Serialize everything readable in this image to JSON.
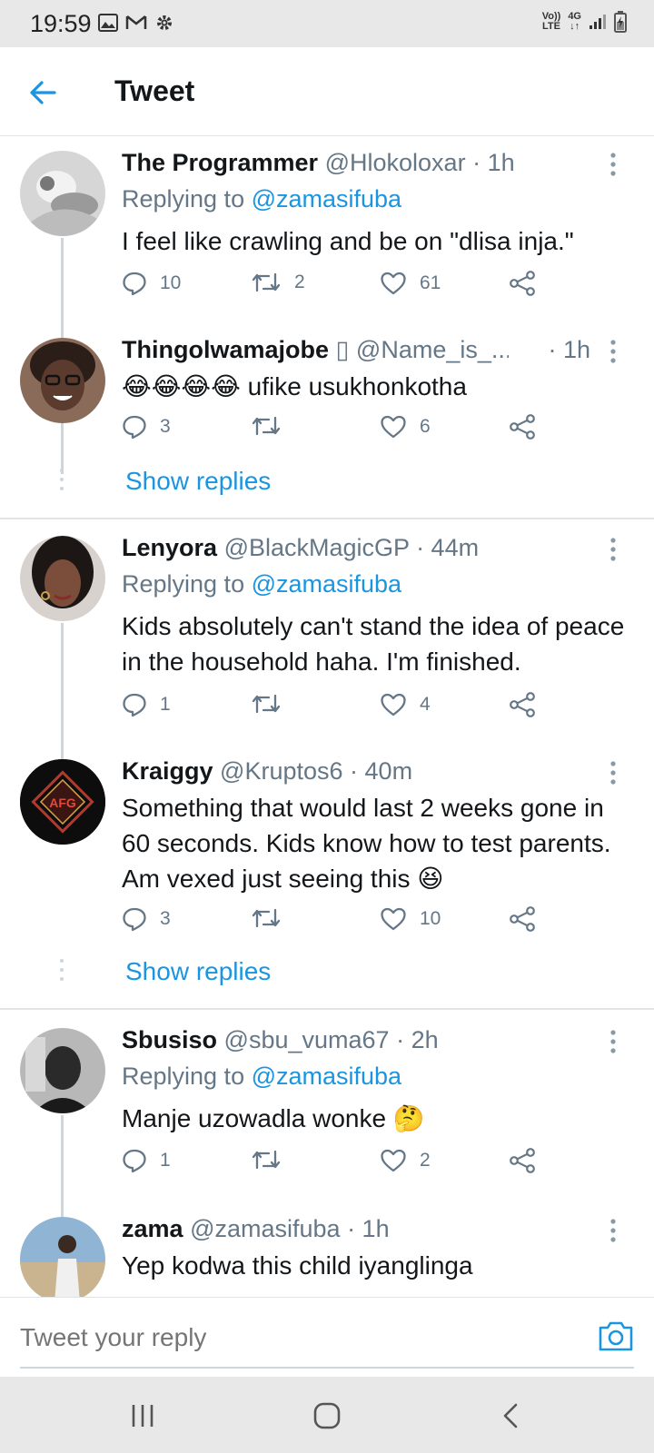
{
  "status_bar": {
    "time": "19:59",
    "network_label_1": "Vo))",
    "network_label_2": "LTE",
    "network_type": "4G"
  },
  "header": {
    "title": "Tweet"
  },
  "tweets": [
    {
      "name": "The Programmer",
      "handle": "@Hlokoloxar",
      "time": "· 1h",
      "replying_prefix": "Replying to ",
      "replying_to": "@zamasifuba",
      "text": "I feel like crawling and be on \"dlisa inja.\"",
      "replies": "10",
      "retweets": "2",
      "likes": "61",
      "avatar_color": "#c9c9c9"
    },
    {
      "name": "Thingolwamajobe",
      "name_glyph": "▯",
      "handle": "@Name_is_...",
      "time": "· 1h",
      "text_emoji": "😂😂😂😂",
      "text": "ufike usukhonkotha",
      "replies": "3",
      "retweets": "",
      "likes": "6",
      "avatar_color": "#5a3b2e",
      "show_replies": "Show replies"
    },
    {
      "name": "Lenyora",
      "handle": "@BlackMagicGP",
      "time": "· 44m",
      "replying_prefix": "Replying to ",
      "replying_to": "@zamasifuba",
      "text": "Kids absolutely can't stand the idea of peace in the household haha. I'm finished.",
      "replies": "1",
      "retweets": "",
      "likes": "4",
      "avatar_color": "#3a2a24"
    },
    {
      "name": "Kraiggy",
      "handle": "@Kruptos6",
      "time": "· 40m",
      "text": "Something that would last 2 weeks gone in 60 seconds. Kids know how to test parents. Am vexed just seeing this",
      "text_emoji": "😆",
      "replies": "3",
      "retweets": "",
      "likes": "10",
      "avatar_color": "#0d0d0d",
      "avatar_logo_text": "AFG",
      "show_replies": "Show replies"
    },
    {
      "name": "Sbusiso",
      "handle": "@sbu_vuma67",
      "time": "· 2h",
      "replying_prefix": "Replying to ",
      "replying_to": "@zamasifuba",
      "text": "Manje uzowadla wonke",
      "text_emoji": "🤔",
      "replies": "1",
      "retweets": "",
      "likes": "2",
      "avatar_color": "#6e6e6e"
    },
    {
      "name": "zama",
      "handle": "@zamasifuba",
      "time": "· 1h",
      "text": "Yep kodwa this child iyanglinga",
      "avatar_color": "#7fa7c9"
    }
  ],
  "reply_bar": {
    "placeholder": "Tweet your reply"
  },
  "colors": {
    "accent": "#1b95e0",
    "text_primary": "#14171a",
    "text_secondary": "#657786",
    "divider": "#e1e4e7"
  },
  "icons": {
    "back": "arrow-left-icon",
    "reply": "comment-bubble-icon",
    "retweet": "retweet-icon",
    "like": "heart-icon",
    "share": "share-icon",
    "more": "vertical-dots-icon",
    "camera": "camera-icon"
  }
}
